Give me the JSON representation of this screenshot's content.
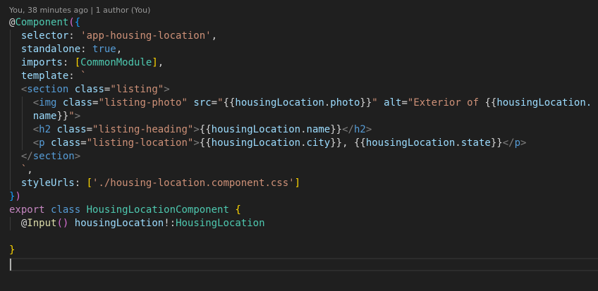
{
  "codelens": {
    "text": "You, 38 minutes ago | 1 author (You)"
  },
  "colors": {
    "background": "#1f1f1f",
    "default": "#d4d4d4",
    "keyword": "#569cd6",
    "control": "#c586c0",
    "type": "#4ec9b0",
    "function": "#dcdcaa",
    "property": "#9cdcfe",
    "string": "#ce9178",
    "tag": "#569cd6",
    "tag_bracket": "#808080",
    "attribute": "#9cdcfe",
    "bracket_gold": "#ffd700",
    "bracket_purple": "#da70d6",
    "bracket_blue": "#179fff",
    "codelens": "#9a9a9a"
  },
  "lines": [
    [
      [
        "@",
        "default"
      ],
      [
        "Component",
        "type"
      ],
      [
        "(",
        "bracket_purple"
      ],
      [
        "{",
        "bracket_blue"
      ]
    ],
    [
      [
        "  ",
        "default"
      ],
      [
        "selector",
        "property"
      ],
      [
        ": ",
        "default"
      ],
      [
        "'app-housing-location'",
        "string"
      ],
      [
        ",",
        "default"
      ]
    ],
    [
      [
        "  ",
        "default"
      ],
      [
        "standalone",
        "property"
      ],
      [
        ": ",
        "default"
      ],
      [
        "true",
        "keyword"
      ],
      [
        ",",
        "default"
      ]
    ],
    [
      [
        "  ",
        "default"
      ],
      [
        "imports",
        "property"
      ],
      [
        ": ",
        "default"
      ],
      [
        "[",
        "bracket_gold"
      ],
      [
        "CommonModule",
        "type"
      ],
      [
        "]",
        "bracket_gold"
      ],
      [
        ",",
        "default"
      ]
    ],
    [
      [
        "  ",
        "default"
      ],
      [
        "template",
        "property"
      ],
      [
        ": ",
        "default"
      ],
      [
        "`",
        "string"
      ]
    ],
    [
      [
        "  ",
        "default"
      ],
      [
        "<",
        "tag_bracket"
      ],
      [
        "section",
        "tag"
      ],
      [
        " ",
        "default"
      ],
      [
        "class",
        "attribute"
      ],
      [
        "=",
        "default"
      ],
      [
        "\"listing\"",
        "string"
      ],
      [
        ">",
        "tag_bracket"
      ]
    ],
    [
      [
        "    ",
        "default"
      ],
      [
        "<",
        "tag_bracket"
      ],
      [
        "img",
        "tag"
      ],
      [
        " ",
        "default"
      ],
      [
        "class",
        "attribute"
      ],
      [
        "=",
        "default"
      ],
      [
        "\"listing-photo\"",
        "string"
      ],
      [
        " ",
        "default"
      ],
      [
        "src",
        "attribute"
      ],
      [
        "=",
        "default"
      ],
      [
        "\"",
        "string"
      ],
      [
        "{{",
        "default"
      ],
      [
        "housingLocation",
        "property"
      ],
      [
        ".",
        "default"
      ],
      [
        "photo",
        "property"
      ],
      [
        "}}",
        "default"
      ],
      [
        "\"",
        "string"
      ],
      [
        " ",
        "default"
      ],
      [
        "alt",
        "attribute"
      ],
      [
        "=",
        "default"
      ],
      [
        "\"Exterior of ",
        "string"
      ],
      [
        "{{",
        "default"
      ],
      [
        "housingLocation.",
        "property"
      ]
    ],
    [
      [
        "    ",
        "default"
      ],
      [
        "name",
        "property"
      ],
      [
        "}}",
        "default"
      ],
      [
        "\"",
        "string"
      ],
      [
        ">",
        "tag_bracket"
      ]
    ],
    [
      [
        "    ",
        "default"
      ],
      [
        "<",
        "tag_bracket"
      ],
      [
        "h2",
        "tag"
      ],
      [
        " ",
        "default"
      ],
      [
        "class",
        "attribute"
      ],
      [
        "=",
        "default"
      ],
      [
        "\"listing-heading\"",
        "string"
      ],
      [
        ">",
        "tag_bracket"
      ],
      [
        "{{",
        "default"
      ],
      [
        "housingLocation",
        "property"
      ],
      [
        ".",
        "default"
      ],
      [
        "name",
        "property"
      ],
      [
        "}}",
        "default"
      ],
      [
        "</",
        "tag_bracket"
      ],
      [
        "h2",
        "tag"
      ],
      [
        ">",
        "tag_bracket"
      ]
    ],
    [
      [
        "    ",
        "default"
      ],
      [
        "<",
        "tag_bracket"
      ],
      [
        "p",
        "tag"
      ],
      [
        " ",
        "default"
      ],
      [
        "class",
        "attribute"
      ],
      [
        "=",
        "default"
      ],
      [
        "\"listing-location\"",
        "string"
      ],
      [
        ">",
        "tag_bracket"
      ],
      [
        "{{",
        "default"
      ],
      [
        "housingLocation",
        "property"
      ],
      [
        ".",
        "default"
      ],
      [
        "city",
        "property"
      ],
      [
        "}}",
        "default"
      ],
      [
        ", ",
        "default"
      ],
      [
        "{{",
        "default"
      ],
      [
        "housingLocation",
        "property"
      ],
      [
        ".",
        "default"
      ],
      [
        "state",
        "property"
      ],
      [
        "}}",
        "default"
      ],
      [
        "</",
        "tag_bracket"
      ],
      [
        "p",
        "tag"
      ],
      [
        ">",
        "tag_bracket"
      ]
    ],
    [
      [
        "  ",
        "default"
      ],
      [
        "</",
        "tag_bracket"
      ],
      [
        "section",
        "tag"
      ],
      [
        ">",
        "tag_bracket"
      ]
    ],
    [
      [
        "  ",
        "default"
      ],
      [
        "`",
        "string"
      ],
      [
        ",",
        "default"
      ]
    ],
    [
      [
        "  ",
        "default"
      ],
      [
        "styleUrls",
        "property"
      ],
      [
        ": ",
        "default"
      ],
      [
        "[",
        "bracket_gold"
      ],
      [
        "'./housing-location.component.css'",
        "string"
      ],
      [
        "]",
        "bracket_gold"
      ]
    ],
    [
      [
        "}",
        "bracket_blue"
      ],
      [
        ")",
        "bracket_purple"
      ]
    ],
    [
      [
        "export",
        "control"
      ],
      [
        " ",
        "default"
      ],
      [
        "class",
        "keyword"
      ],
      [
        " ",
        "default"
      ],
      [
        "HousingLocationComponent",
        "type"
      ],
      [
        " ",
        "default"
      ],
      [
        "{",
        "bracket_gold"
      ]
    ],
    [
      [
        "  ",
        "default"
      ],
      [
        "@",
        "default"
      ],
      [
        "Input",
        "function"
      ],
      [
        "(",
        "bracket_purple"
      ],
      [
        ")",
        "bracket_purple"
      ],
      [
        " ",
        "default"
      ],
      [
        "housingLocation",
        "property"
      ],
      [
        "!:",
        "default"
      ],
      [
        "HousingLocation",
        "type"
      ]
    ],
    [],
    [
      [
        "}",
        "bracket_gold"
      ]
    ]
  ]
}
